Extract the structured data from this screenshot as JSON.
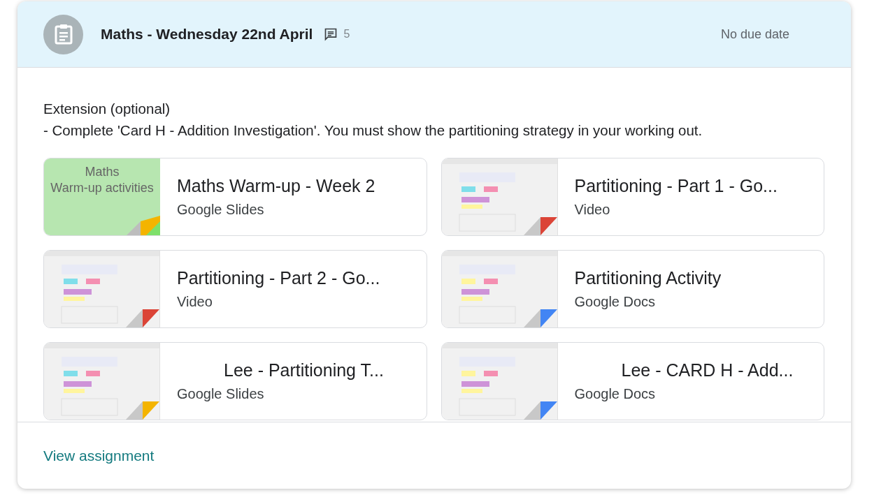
{
  "header": {
    "title": "Maths - Wednesday 22nd April",
    "comment_count": "5",
    "due": "No due date"
  },
  "body": {
    "lines": [
      "Extension (optional)",
      "- Complete 'Card H - Addition Investigation'. You must show the partitioning strategy in your working out."
    ]
  },
  "attachments": [
    {
      "kind": "slides",
      "title": "Maths Warm-up - Week 2",
      "type_label": "Google Slides",
      "thumbnail_title": "Maths\nWarm-up activities",
      "indented": false
    },
    {
      "kind": "video",
      "title": "Partitioning - Part 1 - Go...",
      "type_label": "Video",
      "indented": false
    },
    {
      "kind": "video",
      "title": "Partitioning - Part 2 - Go...",
      "type_label": "Video",
      "indented": false
    },
    {
      "kind": "docs",
      "title": "Partitioning Activity",
      "type_label": "Google Docs",
      "indented": false
    },
    {
      "kind": "slides",
      "title": "Lee - Partitioning T...",
      "type_label": "Google Slides",
      "indented": true
    },
    {
      "kind": "docs",
      "title": "Lee - CARD H - Add...",
      "type_label": "Google Docs",
      "indented": true
    }
  ],
  "footer": {
    "link": "View assignment"
  }
}
